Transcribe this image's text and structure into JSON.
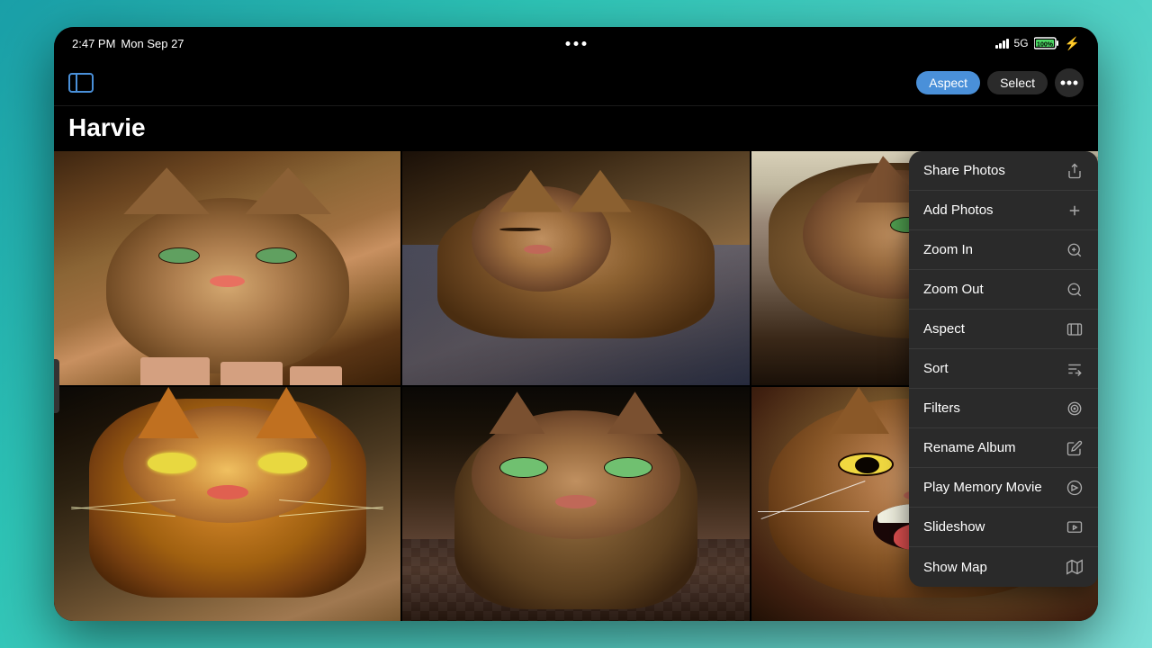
{
  "device": {
    "time": "2:47 PM",
    "date": "Mon Sep 27",
    "network": "5G",
    "battery": "100%",
    "battery_charging": true
  },
  "nav": {
    "album_title": "Harvie",
    "aspect_label": "Aspect",
    "select_label": "Select",
    "more_dots": "•••"
  },
  "menu": {
    "items": [
      {
        "id": "share-photos",
        "label": "Share Photos",
        "icon": "share"
      },
      {
        "id": "add-photos",
        "label": "Add Photos",
        "icon": "plus"
      },
      {
        "id": "zoom-in",
        "label": "Zoom In",
        "icon": "zoom-in"
      },
      {
        "id": "zoom-out",
        "label": "Zoom Out",
        "icon": "zoom-out"
      },
      {
        "id": "aspect",
        "label": "Aspect",
        "icon": "aspect"
      },
      {
        "id": "sort",
        "label": "Sort",
        "icon": "sort"
      },
      {
        "id": "filters",
        "label": "Filters",
        "icon": "filters"
      },
      {
        "id": "rename-album",
        "label": "Rename Album",
        "icon": "pencil"
      },
      {
        "id": "play-memory-movie",
        "label": "Play Memory Movie",
        "icon": "play-memory"
      },
      {
        "id": "slideshow",
        "label": "Slideshow",
        "icon": "slideshow"
      },
      {
        "id": "show-map",
        "label": "Show Map",
        "icon": "map"
      }
    ]
  },
  "photos": [
    {
      "id": 1,
      "alt": "Kitten being held"
    },
    {
      "id": 2,
      "alt": "Cat sleeping on lap"
    },
    {
      "id": 3,
      "alt": "Cat profile view"
    },
    {
      "id": 4,
      "alt": "Artistic cat portrait"
    },
    {
      "id": 5,
      "alt": "Cat looking at camera"
    },
    {
      "id": 6,
      "alt": "Cat with mouth open"
    }
  ]
}
